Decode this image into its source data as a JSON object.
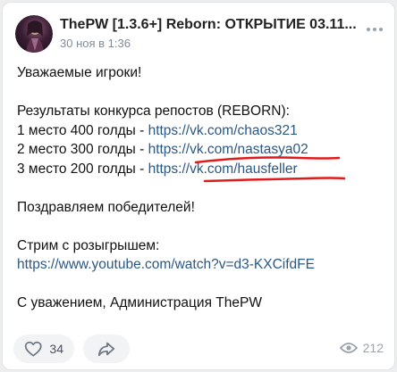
{
  "post": {
    "title": "ThePW [1.3.6+] Reborn: ОТКРЫТИЕ 03.11...",
    "date": "30 ноя в 1:36",
    "lines": {
      "greeting": "Уважаемые игроки!",
      "results_heading": "Результаты конкурса репостов (REBORN):",
      "place1_text": "1 место 400 голды - ",
      "place1_link": "https://vk.com/chaos321",
      "place2_text": "2 место 300 голды - ",
      "place2_link": "https://vk.com/nastasya02",
      "place3_text": "3 место 200 голды - ",
      "place3_link": "https://vk.com/hausfeller",
      "congrats": "Поздравляем победителей!",
      "stream_label": "Стрим с розыгрышем:",
      "stream_link": "https://www.youtube.com/watch?v=d3-KXCifdFE",
      "signature": "С уважением, Администрация ThePW"
    }
  },
  "footer": {
    "likes": "34",
    "views": "212"
  },
  "icons": {
    "avatar": "avatar",
    "more": "more-dots-icon",
    "like": "heart-icon",
    "share": "share-icon",
    "views": "eye-icon"
  },
  "colors": {
    "link": "#2a5885",
    "underline": "#e01b1b",
    "muted": "#818c99"
  }
}
